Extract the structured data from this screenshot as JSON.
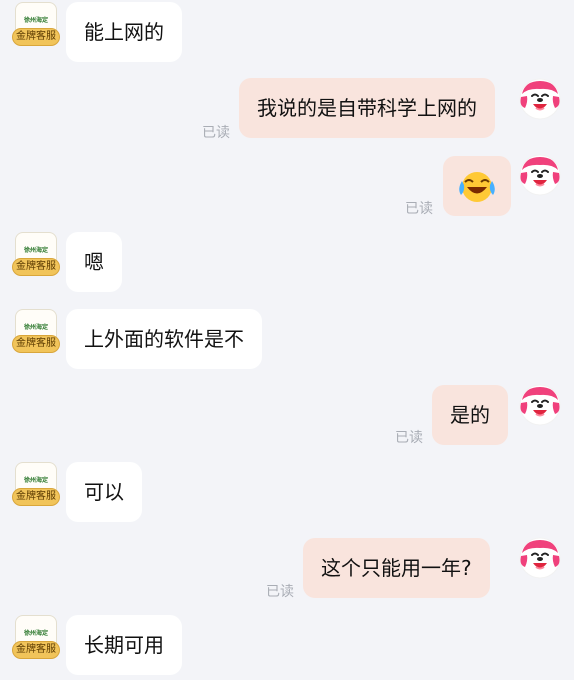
{
  "agent": {
    "logo_text": "徐州海定",
    "badge": "金牌客服"
  },
  "read_label": "已读",
  "messages": [
    {
      "side": "left",
      "text": "能上网的"
    },
    {
      "side": "right",
      "text": "我说的是自带科学上网的",
      "status": "已读"
    },
    {
      "side": "right",
      "emoji": "laughing-crying-emoji",
      "status": "已读"
    },
    {
      "side": "left",
      "text": "嗯"
    },
    {
      "side": "left",
      "text": "上外面的软件是不"
    },
    {
      "side": "right",
      "text": "是的",
      "status": "已读"
    },
    {
      "side": "left",
      "text": "可以"
    },
    {
      "side": "right",
      "text": "这个只能用一年?",
      "status": "已读"
    },
    {
      "side": "left",
      "text": "长期可用"
    }
  ],
  "colors": {
    "background": "#f3f4f8",
    "agent_bubble": "#ffffff",
    "user_bubble": "#f9e4dd",
    "read_text": "#a9adb5",
    "badge": "#f1c45a",
    "user_avatar": "#f0417c"
  }
}
